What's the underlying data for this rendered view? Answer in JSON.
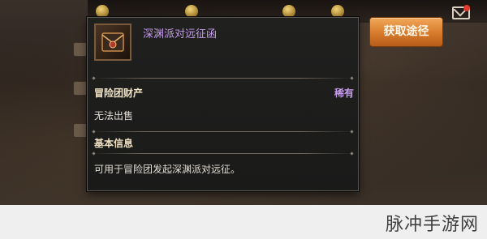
{
  "tooltip": {
    "item_name": "深渊派对远征函",
    "section1_title": "冒险团财产",
    "rarity": "稀有",
    "sell_status": "无法出售",
    "section2_title": "基本信息",
    "description": "可用于冒险团发起深渊派对远征。"
  },
  "buttons": {
    "acquire": "获取途径"
  },
  "watermark": {
    "text": "脉冲手游网"
  },
  "colors": {
    "item_name_color": "#c79bf0",
    "button_orange": "#d77a2b"
  },
  "icons": {
    "item": "expedition-letter-icon",
    "mail": "mail-icon"
  }
}
